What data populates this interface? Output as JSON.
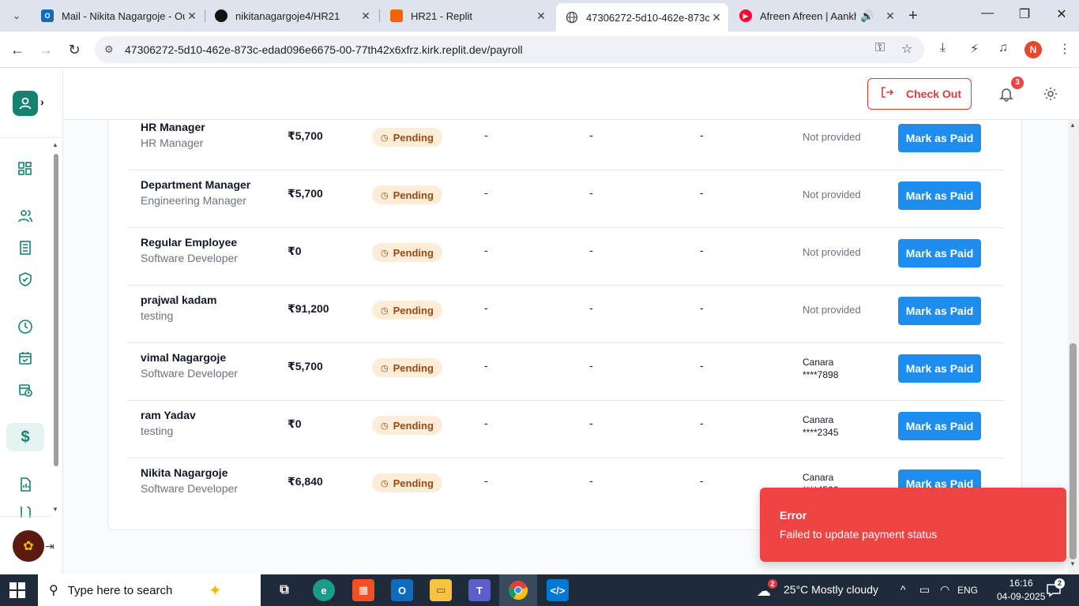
{
  "browser": {
    "tabs": [
      {
        "title": "Mail - Nikita Nagargoje - Ou",
        "favicon": "outlook-icon",
        "color": "#0f6cbd",
        "active": false
      },
      {
        "title": "nikitanagargoje4/HR21",
        "favicon": "github-icon",
        "color": "#111111",
        "active": false
      },
      {
        "title": "HR21 - Replit",
        "favicon": "replit-icon",
        "color": "#f26207",
        "active": false
      },
      {
        "title": "47306272-5d10-462e-873c-",
        "favicon": "globe-icon",
        "color": "#5f6368",
        "active": true
      },
      {
        "title": "Afreen Afreen | Aankhe I",
        "favicon": "youtube-music-icon",
        "color": "#ff0033",
        "active": false
      }
    ],
    "url": "47306272-5d10-462e-873c-edad096e6675-00-77th42x6xfrz.kirk.replit.dev/payroll",
    "profile_initial": "N"
  },
  "app": {
    "header": {
      "checkout_label": "Check Out",
      "notification_count": "3"
    },
    "payroll_rows": [
      {
        "name": "HR Manager",
        "role": "HR Manager",
        "amount": "₹5,700",
        "status": "Pending",
        "c1": "-",
        "c2": "-",
        "c3": "-",
        "bank": "Not provided",
        "action": "Mark as Paid"
      },
      {
        "name": "Department Manager",
        "role": "Engineering Manager",
        "amount": "₹5,700",
        "status": "Pending",
        "c1": "-",
        "c2": "-",
        "c3": "-",
        "bank": "Not provided",
        "action": "Mark as Paid"
      },
      {
        "name": "Regular Employee",
        "role": "Software Developer",
        "amount": "₹0",
        "status": "Pending",
        "c1": "-",
        "c2": "-",
        "c3": "-",
        "bank": "Not provided",
        "action": "Mark as Paid"
      },
      {
        "name": "prajwal kadam",
        "role": "testing",
        "amount": "₹91,200",
        "status": "Pending",
        "c1": "-",
        "c2": "-",
        "c3": "-",
        "bank": "Not provided",
        "action": "Mark as Paid"
      },
      {
        "name": "vimal Nagargoje",
        "role": "Software Developer",
        "amount": "₹5,700",
        "status": "Pending",
        "c1": "-",
        "c2": "-",
        "c3": "-",
        "bank_name": "Canara",
        "bank_account": "****7898",
        "action": "Mark as Paid"
      },
      {
        "name": "ram Yadav",
        "role": "testing",
        "amount": "₹0",
        "status": "Pending",
        "c1": "-",
        "c2": "-",
        "c3": "-",
        "bank_name": "Canara",
        "bank_account": "****2345",
        "action": "Mark as Paid"
      },
      {
        "name": "Nikita Nagargoje",
        "role": "Software Developer",
        "amount": "₹6,840",
        "status": "Pending",
        "c1": "-",
        "c2": "-",
        "c3": "-",
        "bank_name": "Canara",
        "bank_account": "****4566",
        "action": "Mark as Paid"
      }
    ],
    "toast": {
      "title": "Error",
      "message": "Failed to update payment status"
    },
    "colors": {
      "brand": "#13826e",
      "primary_button": "#1f8ded",
      "danger": "#ef4444",
      "pending_bg": "#fdecd8",
      "pending_text": "#9a4a12"
    }
  },
  "taskbar": {
    "search_placeholder": "Type here to search",
    "weather": "25°C  Mostly cloudy",
    "weather_badge": "2",
    "language": "ENG",
    "time": "16:16",
    "date": "04-09-2025",
    "notification_count": "2"
  }
}
